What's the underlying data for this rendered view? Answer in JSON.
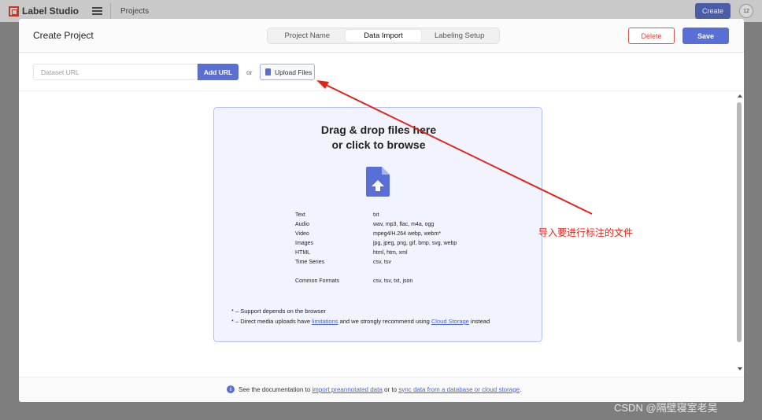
{
  "appbar": {
    "logo_text": "Label Studio",
    "breadcrumb": "Projects",
    "create_label": "Create",
    "avatar_text": "12"
  },
  "modal": {
    "title": "Create Project",
    "tabs": [
      {
        "label": "Project Name",
        "active": false
      },
      {
        "label": "Data Import",
        "active": true
      },
      {
        "label": "Labeling Setup",
        "active": false
      }
    ],
    "delete_label": "Delete",
    "save_label": "Save"
  },
  "import": {
    "url_placeholder": "Dataset URL",
    "add_url_label": "Add URL",
    "or_label": "or",
    "upload_label": "Upload Files"
  },
  "dropzone": {
    "title_line1": "Drag & drop files here",
    "title_line2": "or click to browse",
    "formats": [
      {
        "label": "Text",
        "value": "txt"
      },
      {
        "label": "Audio",
        "value": "wav, mp3, flac, m4a, ogg"
      },
      {
        "label": "Video",
        "value": "mpeg4/H.264 webp, webm*"
      },
      {
        "label": "Images",
        "value": "jpg, jpeg, png, gif, bmp, svg, webp"
      },
      {
        "label": "HTML",
        "value": "html, htm, xml"
      },
      {
        "label": "Time Series",
        "value": "csv, tsv"
      },
      {
        "label": "Common Formats",
        "value": "csv, tsv, txt, json"
      }
    ],
    "note1": "* – Support depends on the browser",
    "note2_prefix": "* – Direct media uploads have ",
    "note2_link1": "limitations",
    "note2_middle": " and we strongly recommend using ",
    "note2_link2": "Cloud Storage",
    "note2_suffix": " instead"
  },
  "footer": {
    "prefix": "See the documentation to ",
    "link1": "import preannotated data",
    "middle": " or to ",
    "link2": "sync data from a database or cloud storage",
    "suffix": "."
  },
  "annotation": {
    "text": "导入要进行标注的文件",
    "color": "#e2231a"
  },
  "watermark": "CSDN @隔壁寝室老吴",
  "colors": {
    "primary": "#5a6fd6",
    "danger": "#d64545",
    "dropzone_bg": "#f1f3fe"
  }
}
